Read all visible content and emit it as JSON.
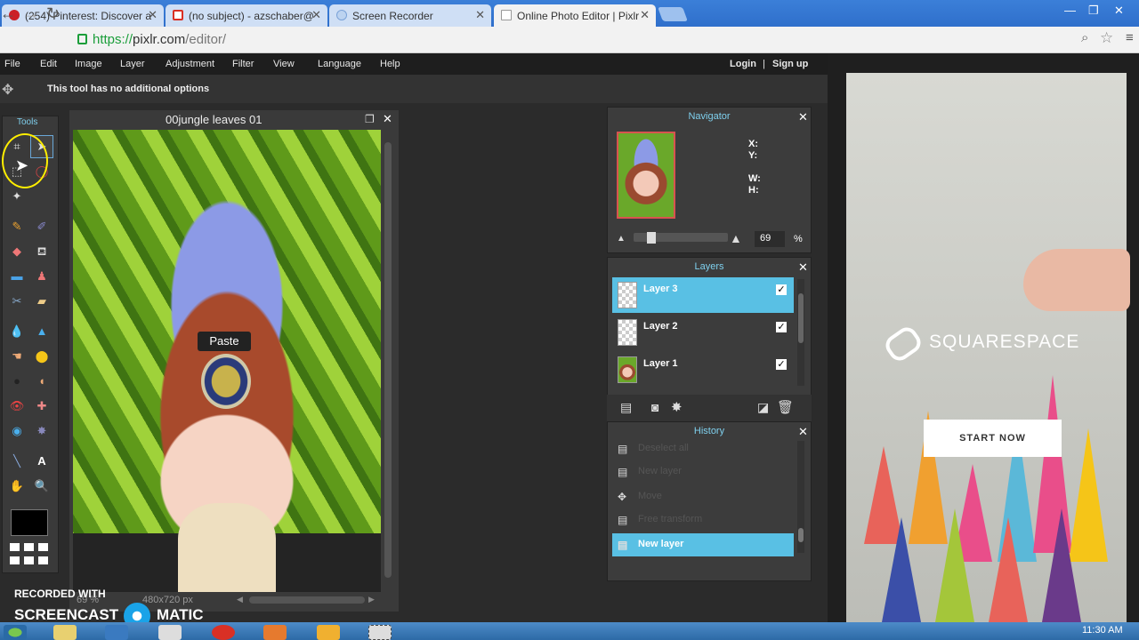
{
  "browser": {
    "tabs": [
      {
        "label": "(254) Pinterest: Discover a",
        "icon": "pinterest-icon"
      },
      {
        "label": "(no subject) - azschaber@",
        "icon": "gmail-icon"
      },
      {
        "label": "Screen Recorder",
        "icon": "globe-icon"
      },
      {
        "label": "Online Photo Editor | Pixlr",
        "icon": "document-icon"
      }
    ],
    "url_scheme": "https://",
    "url_host": "pixlr.com",
    "url_path": "/editor/"
  },
  "menu": {
    "items": [
      "File",
      "Edit",
      "Image",
      "Layer",
      "Adjustment",
      "Filter",
      "View",
      "Language",
      "Help"
    ],
    "login": "Login",
    "separator": "|",
    "signup": "Sign up"
  },
  "options_bar": {
    "text": "This tool has no additional options"
  },
  "tools": {
    "title": "Tools"
  },
  "image_window": {
    "title": "00jungle leaves 01",
    "zoom": "69 %",
    "size": "480x720 px",
    "paste_tooltip": "Paste"
  },
  "navigator": {
    "title": "Navigator",
    "x_label": "X:",
    "y_label": "Y:",
    "w_label": "W:",
    "h_label": "H:",
    "zoom_value": "69",
    "zoom_unit": "%"
  },
  "layers": {
    "title": "Layers",
    "items": [
      {
        "name": "Layer 3",
        "selected": true,
        "visible": true
      },
      {
        "name": "Layer 2",
        "selected": false,
        "visible": true
      },
      {
        "name": "Layer 1",
        "selected": false,
        "visible": true
      }
    ],
    "check": "✓"
  },
  "history": {
    "title": "History",
    "items": [
      {
        "label": "Deselect all"
      },
      {
        "label": "New layer"
      },
      {
        "label": "Move"
      },
      {
        "label": "Free transform"
      },
      {
        "label": "New layer"
      }
    ]
  },
  "ad": {
    "brand": "SQUARESPACE",
    "cta": "START NOW"
  },
  "watermark": {
    "line1": "RECORDED WITH",
    "line2a": "SCREENCAST",
    "line2b": "MATIC"
  },
  "taskbar": {
    "clock": "11:30 AM"
  },
  "colors": {
    "accent": "#59c0e4",
    "panel_title": "#7fd0ee",
    "highlight_ring": "#ffee00"
  }
}
